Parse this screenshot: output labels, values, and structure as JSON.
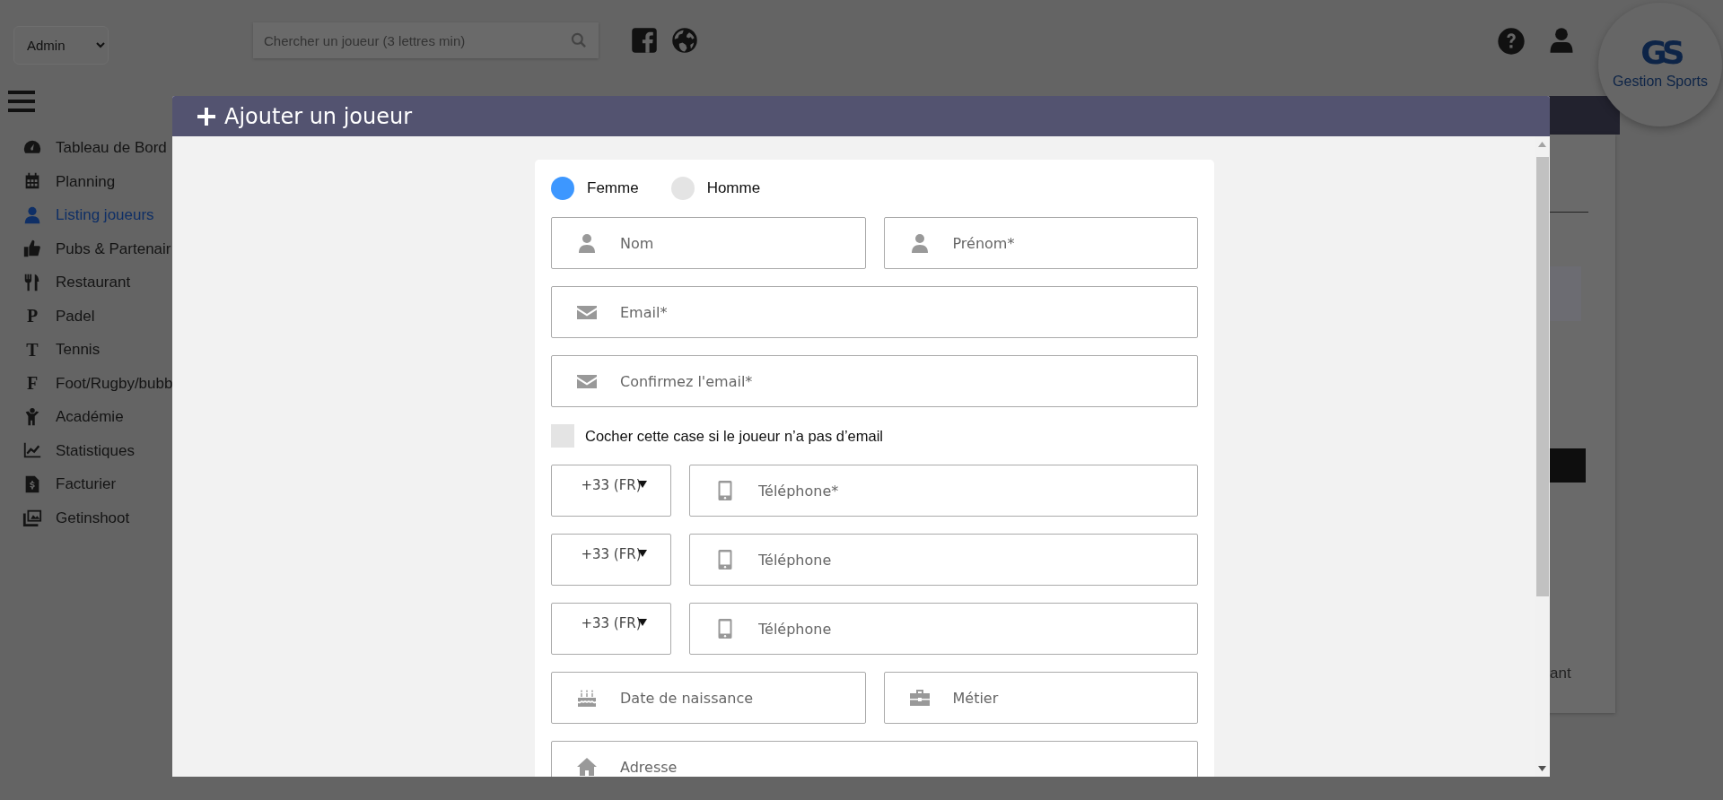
{
  "role_select": {
    "value": "Admin"
  },
  "search": {
    "placeholder": "Chercher un joueur (3 lettres min)"
  },
  "menu": [
    {
      "label": "Tableau de Bord",
      "selected": false
    },
    {
      "label": "Planning",
      "selected": false
    },
    {
      "label": "Listing joueurs",
      "selected": true
    },
    {
      "label": "Pubs & Partenair",
      "selected": false
    },
    {
      "label": "Restaurant",
      "selected": false
    },
    {
      "label": "Padel",
      "letter": "P",
      "selected": false
    },
    {
      "label": "Tennis",
      "letter": "T",
      "selected": false
    },
    {
      "label": "Foot/Rugby/bubb",
      "letter": "F",
      "selected": false
    },
    {
      "label": "Académie",
      "selected": false
    },
    {
      "label": "Statistiques",
      "selected": false
    },
    {
      "label": "Facturier",
      "selected": false
    },
    {
      "label": "Getinshoot",
      "selected": false
    }
  ],
  "logo": {
    "monogram": "GS",
    "name": "Gestion Sports"
  },
  "background_panel": {
    "text": "ant"
  },
  "modal": {
    "title": "Ajouter un joueur",
    "gender": [
      {
        "label": "Femme",
        "selected": true
      },
      {
        "label": "Homme",
        "selected": false
      }
    ],
    "rows_before": [
      [
        {
          "kind": "person",
          "placeholder": "Nom"
        },
        {
          "kind": "person",
          "placeholder": "Prénom*"
        }
      ],
      [
        {
          "kind": "email",
          "placeholder": "Email*"
        }
      ],
      [
        {
          "kind": "email",
          "placeholder": "Confirmez l'email*"
        }
      ]
    ],
    "no_email": {
      "label": "Cocher cette case si le joueur n’a pas d’email",
      "checked": false
    },
    "rows_after": [
      [
        {
          "kind": "country",
          "value": "+33 (FR)"
        },
        {
          "kind": "phone",
          "placeholder": "Téléphone*"
        }
      ],
      [
        {
          "kind": "country",
          "value": "+33 (FR)"
        },
        {
          "kind": "phone",
          "placeholder": "Téléphone"
        }
      ],
      [
        {
          "kind": "country",
          "value": "+33 (FR)"
        },
        {
          "kind": "phone",
          "placeholder": "Téléphone"
        }
      ],
      [
        {
          "kind": "birthday",
          "placeholder": "Date de naissance"
        },
        {
          "kind": "job",
          "placeholder": "Métier"
        }
      ],
      [
        {
          "kind": "address",
          "placeholder": "Adresse"
        }
      ]
    ]
  }
}
